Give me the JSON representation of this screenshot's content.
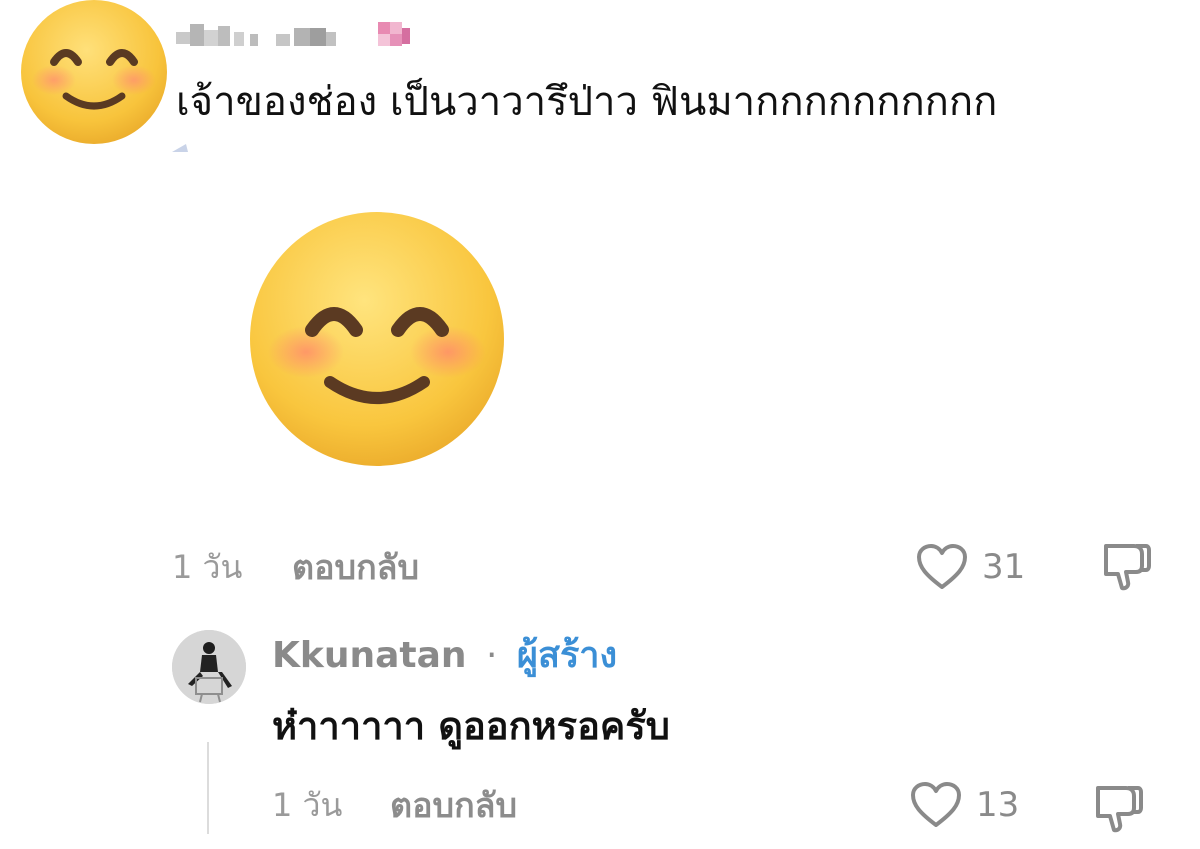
{
  "comment": {
    "author_blurred": true,
    "text": "เจ้าของช่อง เป็นวาวารึป่าว ฟินมากกกกกกกกกก",
    "sticker": "smiling-face-with-smiling-eyes",
    "time": "1 วัน",
    "reply_label": "ตอบกลับ",
    "like_count": "31"
  },
  "reply": {
    "author": "Kkunatan",
    "separator": "·",
    "badge": "ผู้สร้าง",
    "text": "ห๋าาาาาา ดูออกหรอครับ",
    "time": "1 วัน",
    "reply_label": "ตอบกลับ",
    "like_count": "13"
  },
  "colors": {
    "creator_badge": "#3b8fd6",
    "meta_text": "#8c8c8c"
  }
}
